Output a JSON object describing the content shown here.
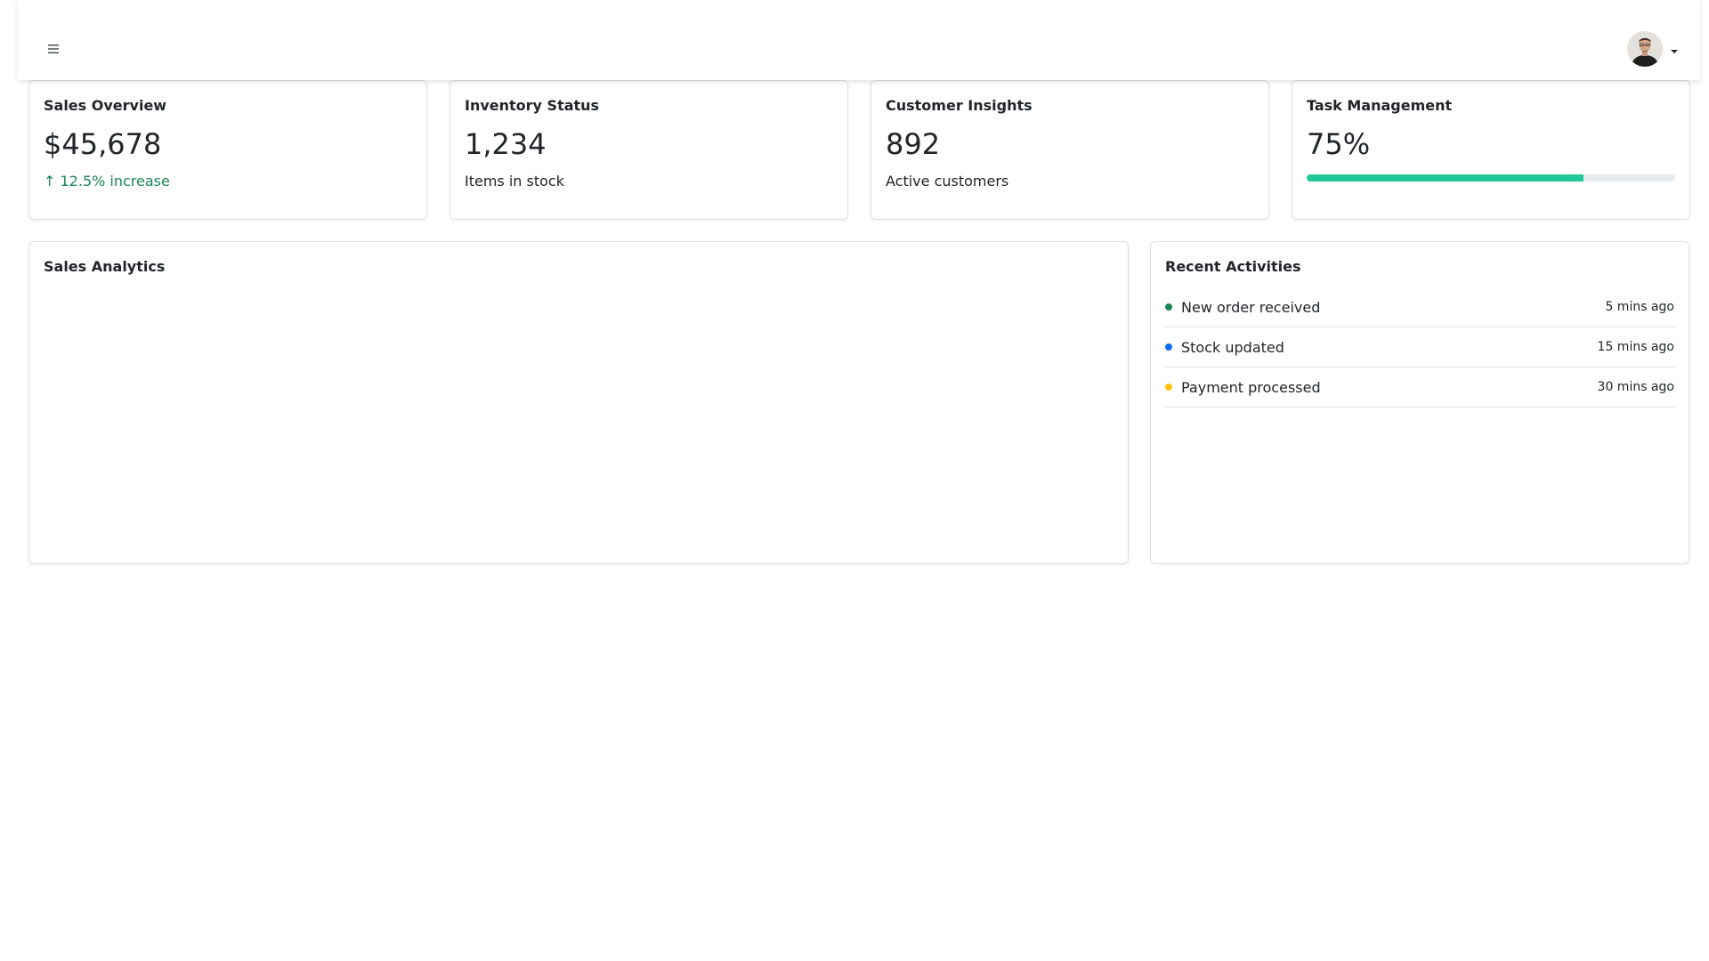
{
  "header": {
    "menu_icon": "hamburger-menu-icon",
    "avatar_icon": "user-avatar",
    "dropdown_icon": "caret-down-icon"
  },
  "cards": {
    "sales": {
      "title": "Sales Overview",
      "value": "$45,678",
      "change": "↑ 12.5% increase"
    },
    "inventory": {
      "title": "Inventory Status",
      "value": "1,234",
      "subtitle": "Items in stock"
    },
    "customers": {
      "title": "Customer Insights",
      "value": "892",
      "subtitle": "Active customers"
    },
    "tasks": {
      "title": "Task Management",
      "value": "75%",
      "progress_fraction": 0.75
    }
  },
  "analytics": {
    "title": "Sales Analytics"
  },
  "activities": {
    "title": "Recent Activities",
    "items": [
      {
        "text": "New order received",
        "time": "5 mins ago",
        "color": "#198754"
      },
      {
        "text": "Stock updated",
        "time": "15 mins ago",
        "color": "#0d6efd"
      },
      {
        "text": "Payment processed",
        "time": "30 mins ago",
        "color": "#ffc107"
      }
    ]
  },
  "colors": {
    "positive": "#198754",
    "progress": "#20c997",
    "border": "#dee2e6"
  }
}
